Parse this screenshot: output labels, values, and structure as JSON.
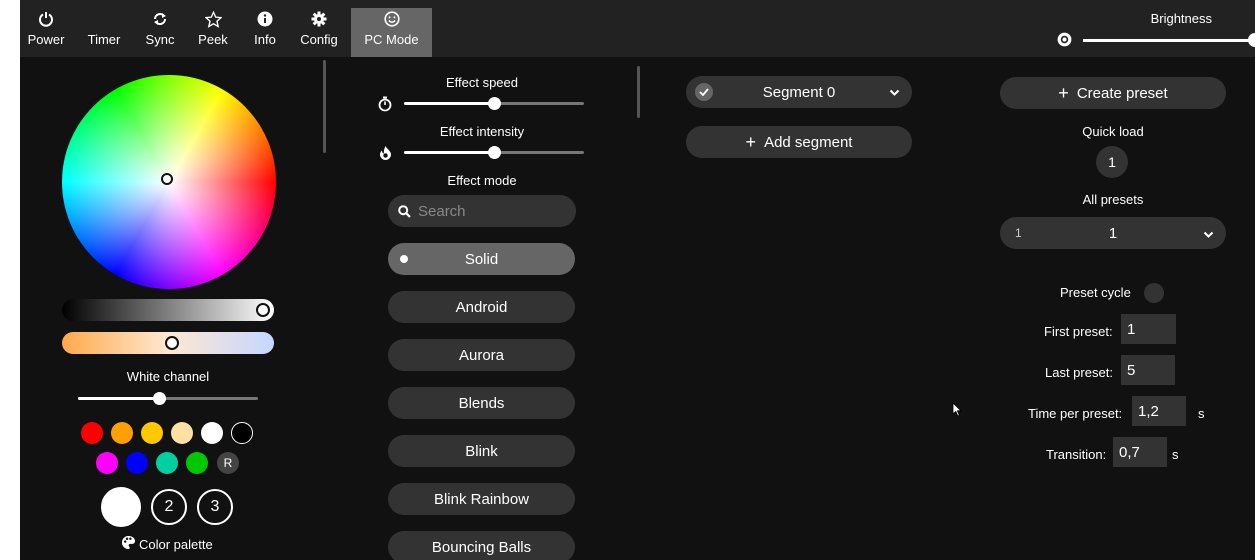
{
  "nav": {
    "items": [
      {
        "label": "Power",
        "icon": "power-icon"
      },
      {
        "label": "Timer",
        "icon": "moon-icon"
      },
      {
        "label": "Sync",
        "icon": "sync-icon"
      },
      {
        "label": "Peek",
        "icon": "star-icon"
      },
      {
        "label": "Info",
        "icon": "info-icon"
      },
      {
        "label": "Config",
        "icon": "gear-icon"
      },
      {
        "label": "PC Mode",
        "icon": "smiley-icon"
      }
    ],
    "brightness_label": "Brightness",
    "brightness_level": 1.0
  },
  "color_panel": {
    "white_channel_label": "White channel",
    "white_channel_level": 0.45,
    "swatches_row1": [
      "#ff0000",
      "#ffa000",
      "#ffc800",
      "#ffe0a0",
      "#ffffff",
      "#000000"
    ],
    "swatches_row2": [
      "#ff00ff",
      "#0000ff",
      "#00d0a0",
      "#00c800"
    ],
    "random_label": "R",
    "slots": [
      "",
      "2",
      "3"
    ],
    "palette_label": "Color palette"
  },
  "effects": {
    "speed_label": "Effect speed",
    "speed_level": 0.5,
    "intensity_label": "Effect intensity",
    "intensity_level": 0.5,
    "mode_label": "Effect mode",
    "search_placeholder": "Search",
    "list": [
      "Solid",
      "Android",
      "Aurora",
      "Blends",
      "Blink",
      "Blink Rainbow",
      "Bouncing Balls"
    ],
    "selected": "Solid"
  },
  "segments": {
    "segment_label": "Segment 0",
    "add_label": "Add segment"
  },
  "presets": {
    "create_label": "Create preset",
    "quick_load_label": "Quick load",
    "quick_load_value": "1",
    "all_presets_label": "All presets",
    "all_presets_id": "1",
    "all_presets_value": "1",
    "cycle_label": "Preset cycle",
    "first_label": "First preset:",
    "first_value": "1",
    "last_label": "Last preset:",
    "last_value": "5",
    "time_label": "Time per preset:",
    "time_value": "1,2",
    "time_unit": "s",
    "transition_label": "Transition:",
    "transition_value": "0,7",
    "transition_unit": "s"
  }
}
